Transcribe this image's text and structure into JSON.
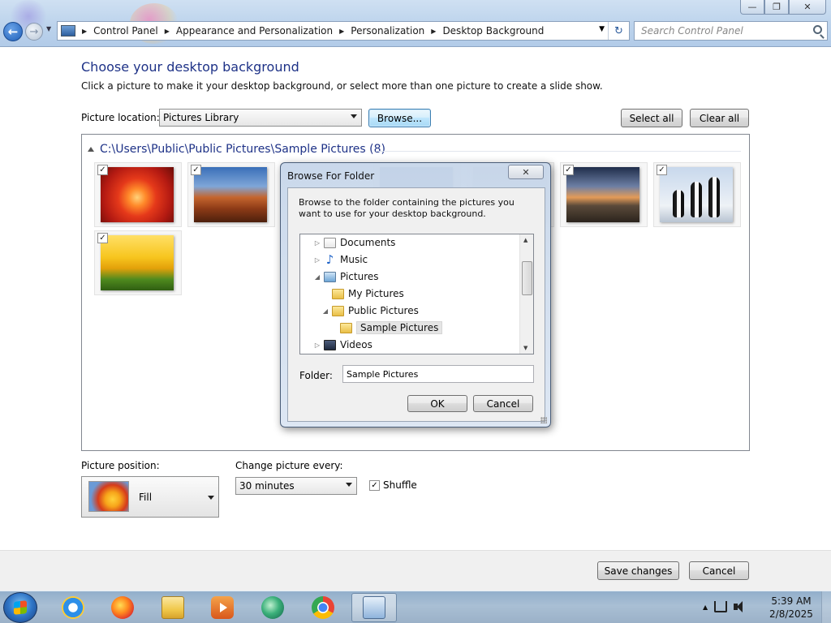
{
  "window": {
    "minimize_glyph": "—",
    "maximize_glyph": "❐",
    "close_glyph": "✕"
  },
  "address_bar": {
    "breadcrumbs": [
      "Control Panel",
      "Appearance and Personalization",
      "Personalization",
      "Desktop Background"
    ],
    "refresh_glyph": "↻"
  },
  "search": {
    "placeholder": "Search Control Panel"
  },
  "main": {
    "title": "Choose your desktop background",
    "description": "Click a picture to make it your desktop background, or select more than one picture to create a slide show.",
    "picture_location_label": "Picture location:",
    "picture_location_value": "Pictures Library",
    "browse_label": "Browse...",
    "select_all_label": "Select all",
    "clear_all_label": "Clear all"
  },
  "gallery": {
    "group_title": "C:\\Users\\Public\\Public Pictures\\Sample Pictures (8)",
    "thumbnails": [
      {
        "name": "flower",
        "checked": true
      },
      {
        "name": "desert",
        "checked": true
      },
      {
        "name": "hidden-1",
        "checked": true
      },
      {
        "name": "hidden-2",
        "checked": true
      },
      {
        "name": "lighthouse",
        "checked": true
      },
      {
        "name": "penguins",
        "checked": true
      },
      {
        "name": "tulips",
        "checked": true
      }
    ],
    "check_glyph": "✓"
  },
  "bottom": {
    "position_label": "Picture position:",
    "position_value": "Fill",
    "change_label": "Change picture every:",
    "change_value": "30 minutes",
    "shuffle_label": "Shuffle",
    "shuffle_checked": true
  },
  "footer": {
    "save_label": "Save changes",
    "cancel_label": "Cancel"
  },
  "dialog": {
    "title": "Browse For Folder",
    "close_glyph": "✕",
    "description": "Browse to the folder containing the pictures you want to use for your desktop background.",
    "tree": [
      {
        "label": "Documents",
        "icon": "document-icon",
        "expander": "▷"
      },
      {
        "label": "Music",
        "icon": "music-icon",
        "expander": "▷"
      },
      {
        "label": "Pictures",
        "icon": "pictures-icon",
        "expander": "◢"
      },
      {
        "label": "My Pictures",
        "icon": "folder-icon",
        "expander": ""
      },
      {
        "label": "Public Pictures",
        "icon": "folder-icon",
        "expander": "◢"
      },
      {
        "label": "Sample Pictures",
        "icon": "folder-open-icon",
        "expander": "",
        "selected": true
      },
      {
        "label": "Videos",
        "icon": "videos-icon",
        "expander": "▷"
      }
    ],
    "folder_label": "Folder:",
    "folder_value": "Sample Pictures",
    "ok_label": "OK",
    "cancel_label": "Cancel"
  },
  "taskbar": {
    "apps": [
      "internet-explorer",
      "firefox",
      "file-explorer",
      "media-player",
      "mailbird",
      "chrome",
      "control-panel"
    ],
    "tray_up_glyph": "▲",
    "time": "5:39 AM",
    "date": "2/8/2025"
  }
}
